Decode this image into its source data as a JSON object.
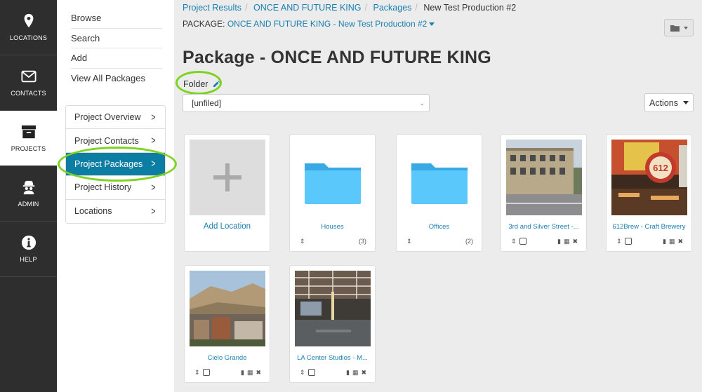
{
  "rail": [
    {
      "label": "LOCATIONS",
      "icon": "map-marker-icon"
    },
    {
      "label": "CONTACTS",
      "icon": "envelope-icon"
    },
    {
      "label": "PROJECTS",
      "icon": "archive-box-icon",
      "active": true
    },
    {
      "label": "ADMIN",
      "icon": "spy-agent-icon"
    },
    {
      "label": "HELP",
      "icon": "info-circle-icon"
    }
  ],
  "submenu": {
    "links": [
      "Browse",
      "Search",
      "Add",
      "View All Packages"
    ],
    "project_nav": [
      {
        "label": "Project Overview"
      },
      {
        "label": "Project Contacts"
      },
      {
        "label": "Project Packages",
        "active": true
      },
      {
        "label": "Project History"
      },
      {
        "label": "Locations"
      }
    ]
  },
  "breadcrumb": {
    "items": [
      "Project Results",
      "ONCE AND FUTURE KING",
      "Packages"
    ],
    "current": "New Test Production #2"
  },
  "package_line": {
    "prefix": "PACKAGE:",
    "value": "ONCE AND FUTURE KING - New Test Production #2"
  },
  "page_title": "Package - ONCE AND FUTURE KING",
  "folder": {
    "label": "Folder",
    "selected": "[unfiled]"
  },
  "actions_label": "Actions",
  "cards": {
    "add_location": "Add Location",
    "houses": {
      "name": "Houses",
      "count": "(3)"
    },
    "offices": {
      "name": "Offices",
      "count": "(2)"
    },
    "loc1": "3rd and Silver Street -...",
    "loc2": "612Brew - Craft Brewery",
    "loc3": "Cielo Grande",
    "loc4": "LA Center Studios - M..."
  },
  "colors": {
    "accent": "#0d7ea3",
    "link": "#1a7fb0",
    "highlight": "#7ed321",
    "folder": "#5ac8fa"
  }
}
